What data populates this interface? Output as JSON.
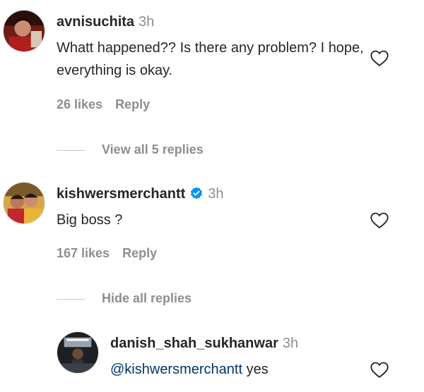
{
  "comments": [
    {
      "username": "avnisuchita",
      "time": "3h",
      "text": "Whatt happened?? Is there any problem? I hope, everything is okay.",
      "likes": "26 likes",
      "reply": "Reply",
      "replies_toggle": "View all 5 replies"
    },
    {
      "username": "kishwersmerchantt",
      "verified": true,
      "time": "3h",
      "text": "Big boss ?",
      "likes": "167 likes",
      "reply": "Reply",
      "replies_toggle": "Hide all replies"
    }
  ],
  "reply": {
    "username": "danish_shah_sukhanwar",
    "time": "3h",
    "mention": "@kishwersmerchantt",
    "text": "yes"
  },
  "colors": {
    "text": "#262626",
    "secondary": "#8e8e8e",
    "mention": "#00376b",
    "verified": "#0095f6"
  }
}
